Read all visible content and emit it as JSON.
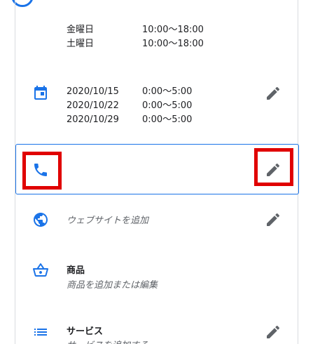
{
  "hours": [
    {
      "day": "金曜日",
      "time": "10:00〜18:00"
    },
    {
      "day": "土曜日",
      "time": "10:00〜18:00"
    }
  ],
  "special_hours": [
    {
      "date": "2020/10/15",
      "time": "0:00〜5:00"
    },
    {
      "date": "2020/10/22",
      "time": "0:00〜5:00"
    },
    {
      "date": "2020/10/29",
      "time": "0:00〜5:00"
    }
  ],
  "website": {
    "placeholder": "ウェブサイトを追加"
  },
  "products": {
    "title": "商品",
    "subtitle": "商品を追加または編集"
  },
  "services": {
    "title": "サービス",
    "subtitle": "サービスを追加する"
  },
  "colors": {
    "accent": "#1a73e8",
    "highlight": "#e00000",
    "icon_gray": "#5f6368"
  }
}
